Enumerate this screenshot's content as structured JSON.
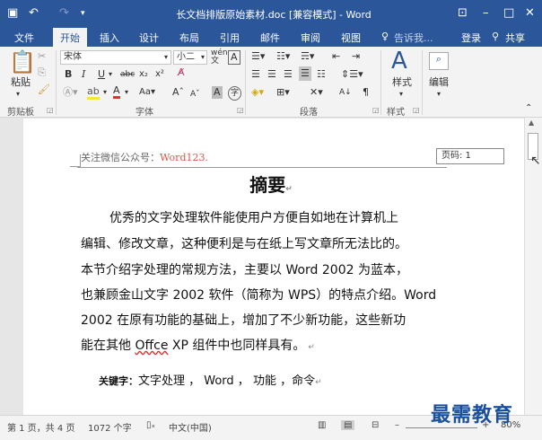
{
  "window": {
    "title": "长文档排版原始素材.doc [兼容模式] - Word"
  },
  "quick_access": {
    "save_icon": "save-icon",
    "undo": "↶",
    "redo": "↷"
  },
  "window_controls": {
    "ribbon_display": "⊡",
    "minimize": "–",
    "maximize": "□",
    "close": "✕"
  },
  "tabs": [
    "文件",
    "开始",
    "插入",
    "设计",
    "布局",
    "引用",
    "邮件",
    "审阅",
    "视图"
  ],
  "active_tab": "开始",
  "tell_me": "告诉我...",
  "login": "登录",
  "share": "共享",
  "clipboard": {
    "paste": "粘贴",
    "group": "剪贴板"
  },
  "font": {
    "name": "宋体",
    "size": "小二",
    "group": "字体"
  },
  "paragraph": {
    "group": "段落"
  },
  "styles": {
    "label": "样式",
    "group": "样式"
  },
  "editing": {
    "label": "编辑"
  },
  "document": {
    "header": {
      "prefix": "关注微信公众号：",
      "account": "Word123."
    },
    "page_indicator": "页码: 1",
    "heading": "摘要",
    "paragraph_lines": [
      "优秀的文字处理软件能使用户方便自如地在计算机上",
      "编辑、修改文章，这种便利是与在纸上写文章所无法比的。",
      "本节介绍字处理的常规方法，主要以 Word 2002 为蓝本，",
      "也兼顾金山文字 2002 软件（简称为 WPS）的特点介绍。Word",
      "2002 在原有功能的基础上，增加了不少新功能，这些新功",
      "能在其他 Offce XP 组件中也同样具有。"
    ],
    "keywords_label": "关键字：",
    "keywords": "文字处理 ，  Word ，  功能 ，命令"
  },
  "status": {
    "page": "第 1 页，共 4 页",
    "words": "1072 个字",
    "language": "中文(中国)",
    "zoom": "80%"
  },
  "watermark": "最需教育"
}
